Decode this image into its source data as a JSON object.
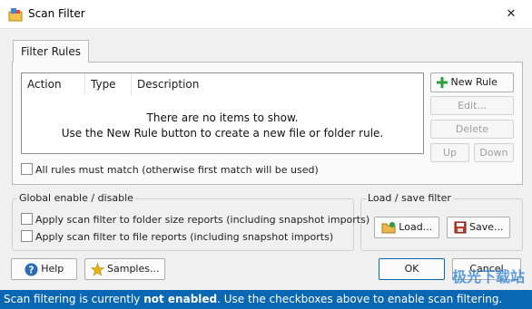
{
  "window": {
    "title": "Scan Filter",
    "close_glyph": "✕"
  },
  "tab": {
    "label": "Filter Rules"
  },
  "list": {
    "columns": [
      "Action",
      "Type",
      "Description"
    ],
    "empty_line1": "There are no items to show.",
    "empty_line2": "Use the New Rule button to create a new file or folder rule."
  },
  "rule_buttons": {
    "new_rule": "New Rule",
    "edit": "Edit...",
    "delete": "Delete",
    "up": "Up",
    "down": "Down"
  },
  "all_rules_match": {
    "label": "All rules must match (otherwise first match will be used)",
    "checked": false
  },
  "global_group": {
    "title": "Global enable / disable",
    "folder_reports": {
      "label": "Apply scan filter to folder size reports (including snapshot imports)",
      "checked": false
    },
    "file_reports": {
      "label": "Apply scan filter to file reports (including snapshot imports)",
      "checked": false
    }
  },
  "load_save_group": {
    "title": "Load / save filter",
    "load": "Load...",
    "save": "Save..."
  },
  "bottom_buttons": {
    "help": "Help",
    "samples": "Samples...",
    "ok": "OK",
    "cancel": "Cancel"
  },
  "status": {
    "prefix": "Scan filtering is currently ",
    "emphasis": "not enabled",
    "suffix": ". Use the checkboxes above to enable scan filtering."
  },
  "watermark": "极光下载站",
  "colors": {
    "status_bg": "#0a67b3",
    "new_rule_plus": "#2e9e3e",
    "help_icon": "#2b6cb5",
    "star": "#e7b416"
  }
}
